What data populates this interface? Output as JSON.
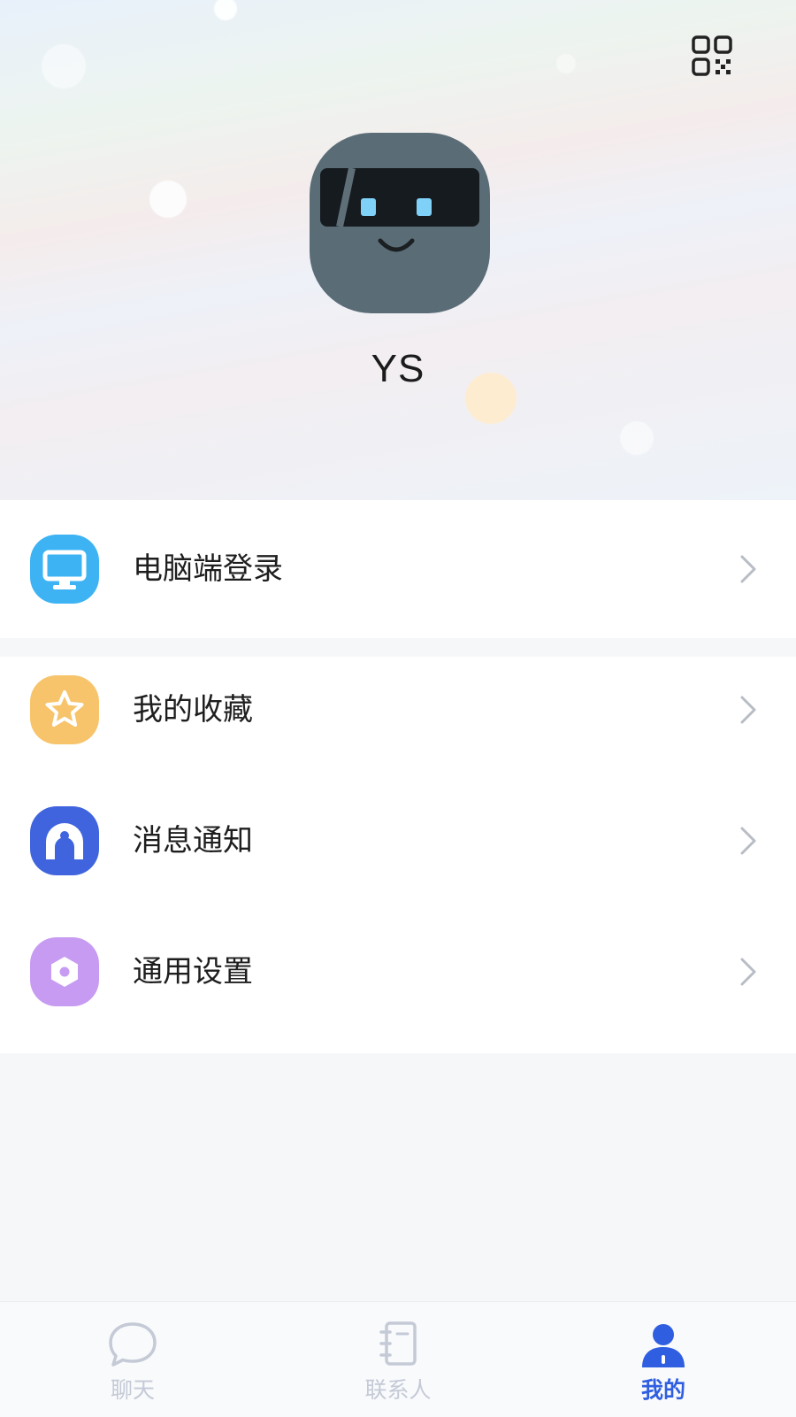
{
  "profile": {
    "username": "YS"
  },
  "menu": {
    "items": [
      {
        "label": "电脑端登录",
        "icon": "monitor-icon",
        "color": "#3db3f3"
      },
      {
        "label": "我的收藏",
        "icon": "star-icon",
        "color": "#f7c46b"
      },
      {
        "label": "消息通知",
        "icon": "notification-icon",
        "color": "#3f64de"
      },
      {
        "label": "通用设置",
        "icon": "settings-hexagon-icon",
        "color": "#c79bf2"
      }
    ]
  },
  "tabbar": {
    "tabs": [
      {
        "label": "聊天",
        "icon": "chat-bubble-icon",
        "active": false
      },
      {
        "label": "联系人",
        "icon": "contacts-book-icon",
        "active": false
      },
      {
        "label": "我的",
        "icon": "person-icon",
        "active": true
      }
    ],
    "active_color": "#2f5fe0",
    "inactive_color": "#c4cad6"
  }
}
